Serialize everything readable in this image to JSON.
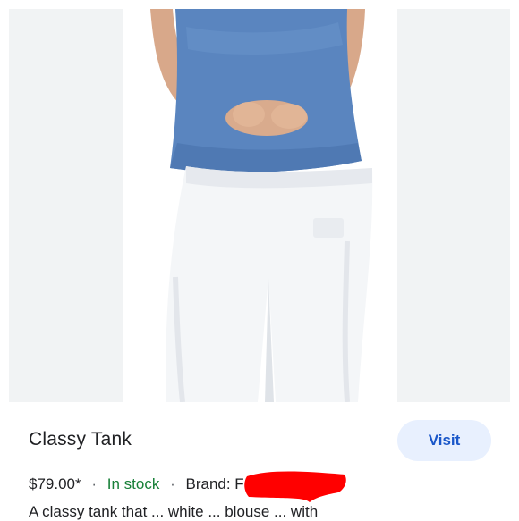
{
  "product": {
    "title": "Classy Tank",
    "visit_label": "Visit",
    "price": "$79.00*",
    "separator": "·",
    "stock_status": "In stock",
    "brand_label": "Brand: F",
    "description_fragment": "A classy tank that ... white ... blouse ... with"
  },
  "image": {
    "content": "Model wearing a blue tank top and white jeans",
    "background_color": "#f1f3f4"
  },
  "colors": {
    "title": "#202124",
    "visit_button_bg": "#e8f0fe",
    "visit_button_text": "#1a57c9",
    "in_stock": "#188038",
    "redaction": "#ff0000"
  }
}
